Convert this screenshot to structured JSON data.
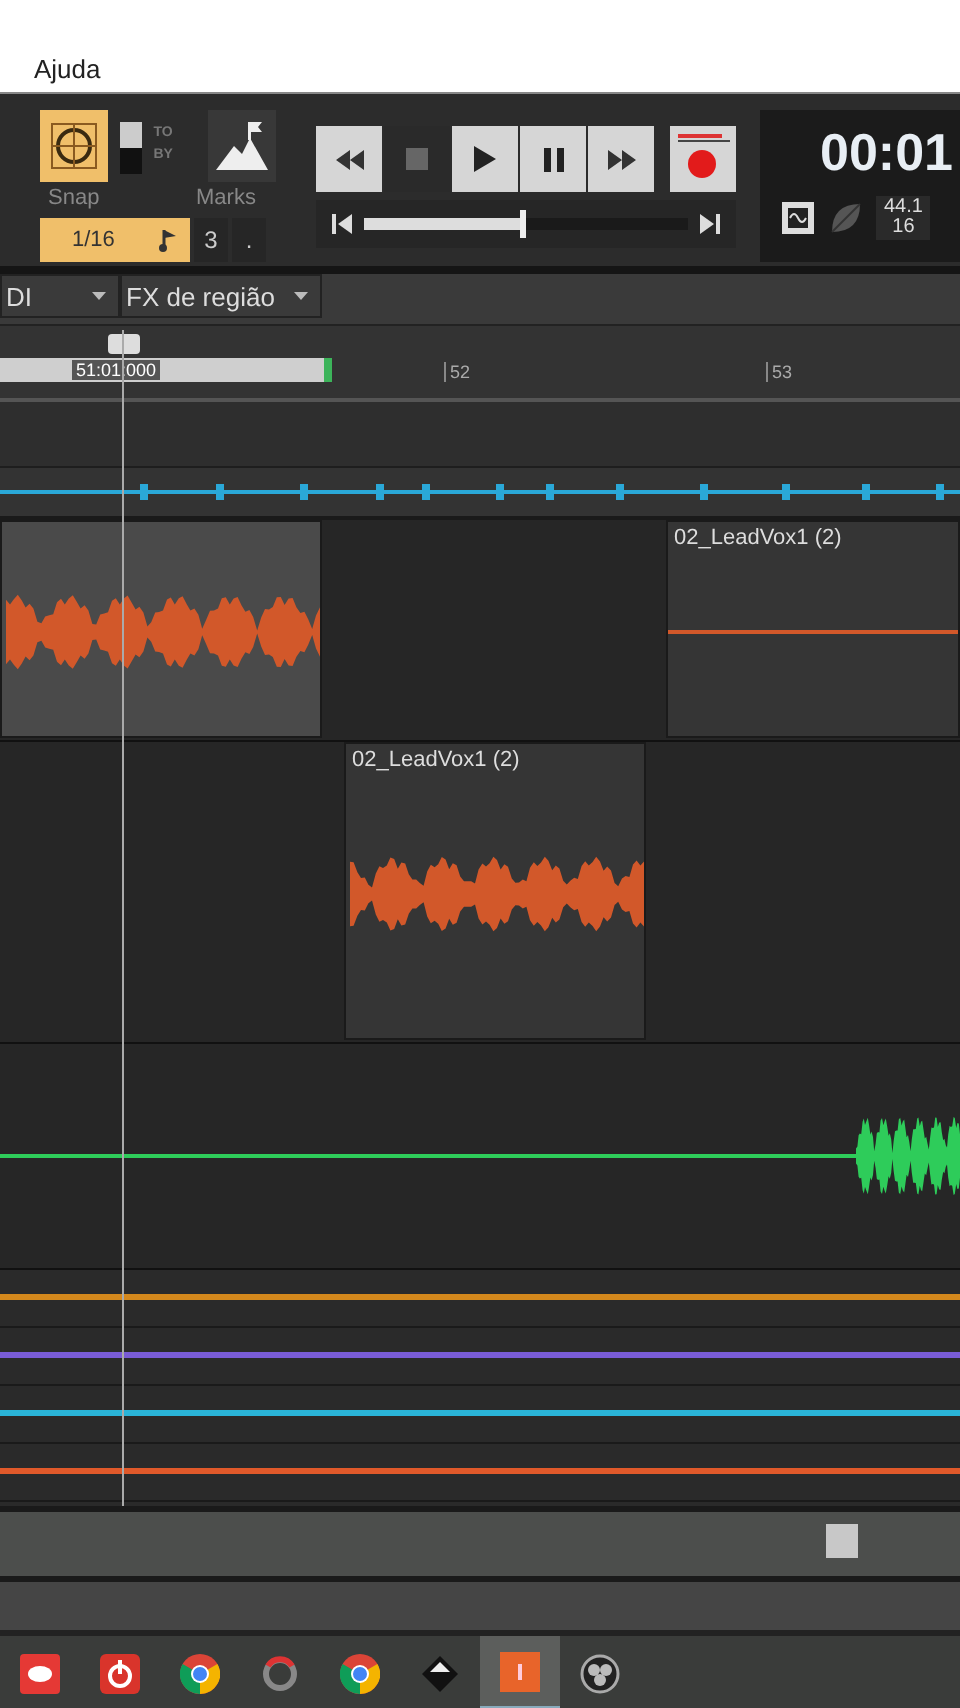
{
  "menu": [
    "Ajuda"
  ],
  "control_bar": {
    "snap": {
      "label": "Snap",
      "on": true,
      "value": "1/16",
      "triplet": "3",
      "dot": "."
    },
    "snap_mode": {
      "labels": [
        "TO",
        "BY"
      ]
    },
    "marks": {
      "label": "Marks"
    },
    "transport": {
      "buttons": [
        {
          "kind": "rewind",
          "selected": false
        },
        {
          "kind": "stop",
          "selected": true
        },
        {
          "kind": "play",
          "selected": false
        },
        {
          "kind": "pause",
          "selected": false
        },
        {
          "kind": "forward",
          "selected": false
        }
      ],
      "position": {
        "level": 0.49
      }
    },
    "time": "00:01",
    "sample_rate": "44.1",
    "bit_depth": "16"
  },
  "toolbar": {
    "dropdowns": [
      "DI",
      "FX de região"
    ]
  },
  "ruler": {
    "marker": "51:01:000",
    "ticks": [
      "52",
      "53"
    ]
  },
  "tracks": [
    {
      "kind": "automation",
      "color": "#2aa8d8"
    },
    {
      "kind": "audio",
      "clips": [
        {
          "kind": "waveform",
          "selected": true
        },
        {
          "kind": "flat",
          "title": "02_LeadVox1 (2)",
          "selected": false
        }
      ]
    },
    {
      "kind": "audio",
      "clips": [
        {
          "kind": "waveform",
          "title": "02_LeadVox1 (2)",
          "selected": false
        }
      ]
    },
    {
      "kind": "green",
      "color": "#2ecc5a"
    }
  ],
  "lanes": [
    {
      "color": "#d4881c"
    },
    {
      "color": "#7a5cd6"
    },
    {
      "color": "#2ab4d8"
    },
    {
      "color": "#e0592a"
    }
  ],
  "taskbar": [
    {
      "kind": "red",
      "selected": false
    },
    {
      "kind": "redpower",
      "selected": false
    },
    {
      "kind": "chrome",
      "selected": false
    },
    {
      "kind": "gray",
      "selected": false
    },
    {
      "kind": "chrome",
      "selected": false
    },
    {
      "kind": "diamond",
      "selected": false
    },
    {
      "kind": "orange",
      "selected": true
    },
    {
      "kind": "obs",
      "selected": false
    }
  ]
}
